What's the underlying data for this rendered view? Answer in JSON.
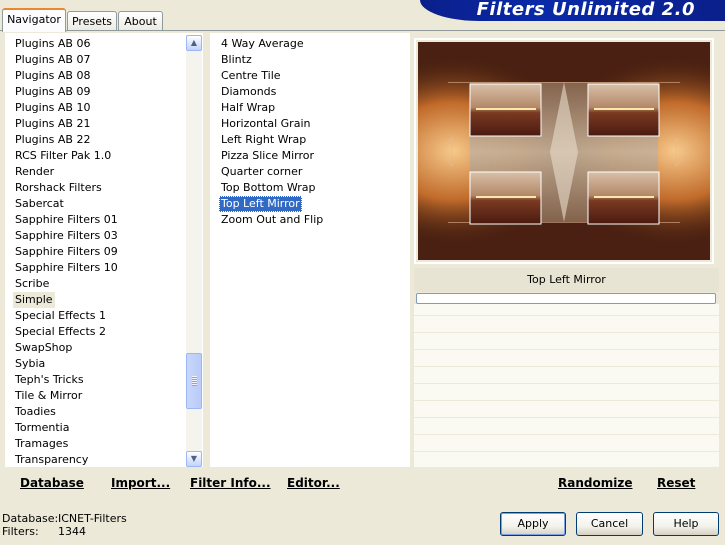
{
  "tabs": [
    {
      "label": "Navigator",
      "active": true
    },
    {
      "label": "Presets",
      "active": false
    },
    {
      "label": "About",
      "active": false
    }
  ],
  "banner": {
    "title": "Filters Unlimited 2.0"
  },
  "categories": {
    "items": [
      "Plugins AB 06",
      "Plugins AB 07",
      "Plugins AB 08",
      "Plugins AB 09",
      "Plugins AB 10",
      "Plugins AB 21",
      "Plugins AB 22",
      "RCS Filter Pak 1.0",
      "Render",
      "Rorshack Filters",
      "Sabercat",
      "Sapphire Filters 01",
      "Sapphire Filters 03",
      "Sapphire Filters 09",
      "Sapphire Filters 10",
      "Scribe",
      "Simple",
      "Special Effects 1",
      "Special Effects 2",
      "SwapShop",
      "Sybia",
      "Teph's Tricks",
      "Tile & Mirror",
      "Toadies",
      "Tormentia",
      "Tramages",
      "Transparency"
    ],
    "selected": "Simple"
  },
  "filters": {
    "items": [
      "4 Way Average",
      "Blintz",
      "Centre Tile",
      "Diamonds",
      "Half Wrap",
      "Horizontal Grain",
      "Left Right Wrap",
      "Pizza Slice Mirror",
      "Quarter corner",
      "Top Bottom Wrap",
      "Top Left Mirror",
      "Zoom Out and Flip"
    ],
    "selected": "Top Left Mirror"
  },
  "preview": {
    "title": "Top Left Mirror"
  },
  "links": {
    "database": "Database",
    "import": "Import...",
    "filter_info": "Filter Info...",
    "editor": "Editor...",
    "randomize": "Randomize",
    "reset": "Reset"
  },
  "status": {
    "database_label": "Database:",
    "database_value": "ICNET-Filters",
    "filters_label": "Filters:",
    "filters_value": "1344"
  },
  "buttons": {
    "apply": "Apply",
    "cancel": "Cancel",
    "help": "Help"
  },
  "icons": {
    "scroll_up": "chevron-up-icon",
    "scroll_down": "chevron-down-icon"
  }
}
